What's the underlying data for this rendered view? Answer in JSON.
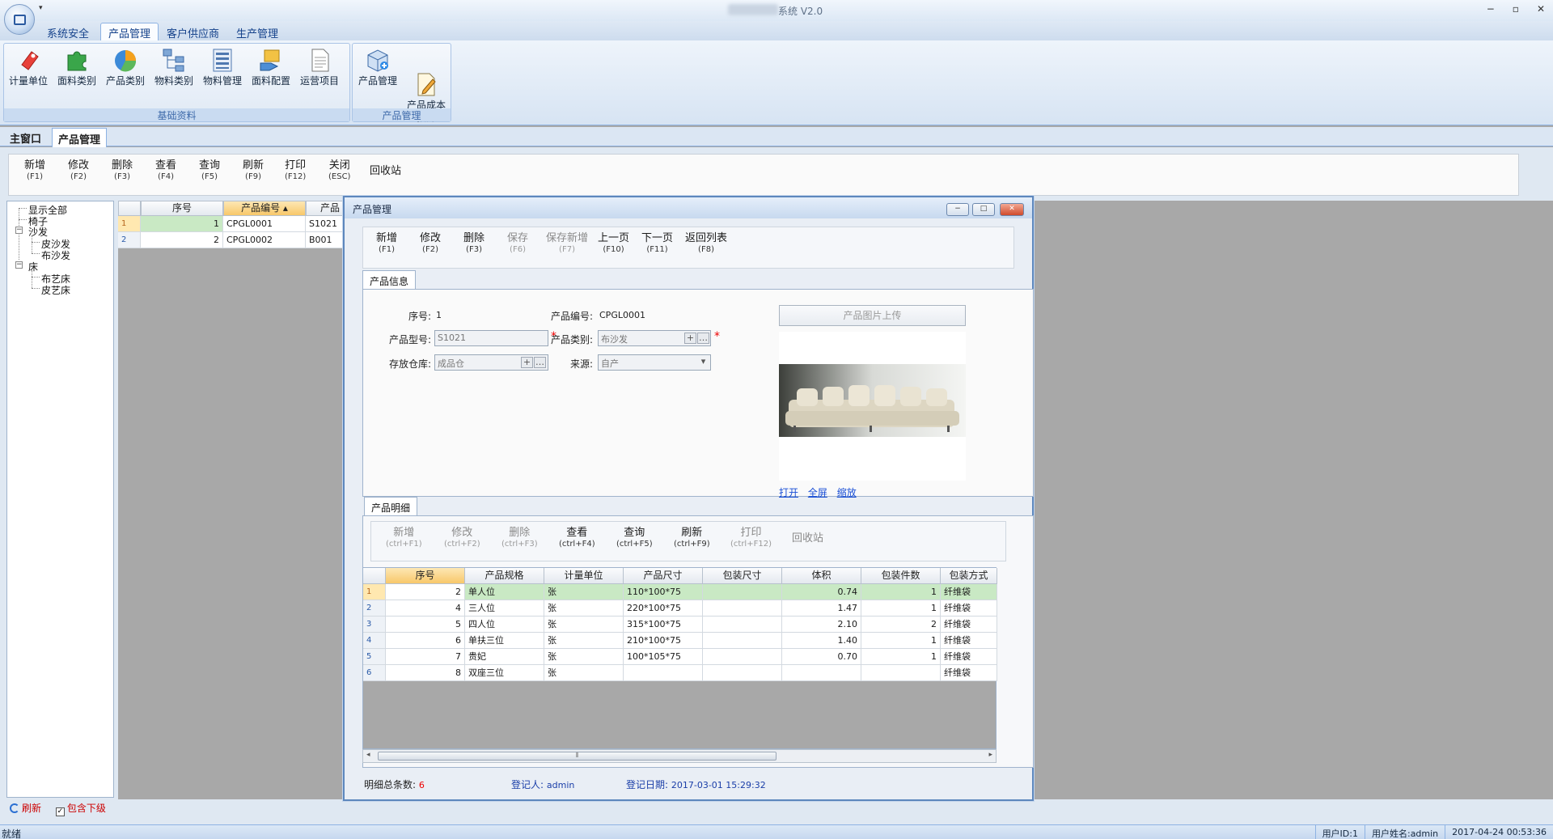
{
  "app": {
    "title": "系统 V2.0",
    "window_controls": [
      "−",
      "▫",
      "✕"
    ]
  },
  "ribbon": {
    "tabs": [
      "系统安全",
      "产品管理",
      "客户供应商",
      "生产管理"
    ],
    "active_tab": "产品管理",
    "groups": [
      {
        "label": "基础资料",
        "buttons": [
          {
            "label": "计量单位",
            "icon": "tag-icon"
          },
          {
            "label": "面料类别",
            "icon": "puzzle-icon"
          },
          {
            "label": "产品类别",
            "icon": "pie-icon"
          },
          {
            "label": "物料类别",
            "icon": "tree-icon"
          },
          {
            "label": "物料管理",
            "icon": "list-icon"
          },
          {
            "label": "面料配置",
            "icon": "hand-icon"
          },
          {
            "label": "运营项目",
            "icon": "document-icon"
          }
        ]
      },
      {
        "label": "产品管理",
        "buttons": [
          {
            "label": "产品管理",
            "icon": "box-icon"
          },
          {
            "label": "产品成本\n预算",
            "icon": "edit-icon"
          }
        ]
      }
    ]
  },
  "doc_tabs": [
    "主窗口",
    "产品管理"
  ],
  "main_toolbar": [
    {
      "label": "新增",
      "key": "(F1)"
    },
    {
      "label": "修改",
      "key": "(F2)"
    },
    {
      "label": "删除",
      "key": "(F3)"
    },
    {
      "label": "查看",
      "key": "(F4)"
    },
    {
      "label": "查询",
      "key": "(F5)"
    },
    {
      "label": "刷新",
      "key": "(F9)"
    },
    {
      "label": "打印",
      "key": "(F12)"
    },
    {
      "label": "关闭",
      "key": "(ESC)"
    },
    {
      "label": "回收站",
      "key": ""
    }
  ],
  "tree": {
    "show_all": "显示全部",
    "nodes": [
      "椅子",
      "沙发",
      "皮沙发",
      "布沙发",
      "床",
      "布艺床",
      "皮艺床"
    ],
    "footer_refresh": "刷新",
    "footer_include": "包含下级",
    "include_checked": "✓"
  },
  "main_grid": {
    "columns": [
      "序号",
      "产品编号",
      "产品"
    ],
    "rows": [
      {
        "n": "1",
        "seq": "1",
        "code": "CPGL0001",
        "model": "S1021"
      },
      {
        "n": "2",
        "seq": "2",
        "code": "CPGL0002",
        "model": "B001"
      }
    ]
  },
  "dialog": {
    "title": "产品管理",
    "buttons": [
      "−",
      "□",
      "✕"
    ],
    "toolbar": [
      {
        "label": "新增",
        "key": "(F1)",
        "enabled": true
      },
      {
        "label": "修改",
        "key": "(F2)",
        "enabled": true
      },
      {
        "label": "删除",
        "key": "(F3)",
        "enabled": true
      },
      {
        "label": "保存",
        "key": "(F6)",
        "enabled": false
      },
      {
        "label": "保存新增",
        "key": "(F7)",
        "enabled": false
      },
      {
        "label": "上一页",
        "key": "(F10)",
        "enabled": true
      },
      {
        "label": "下一页",
        "key": "(F11)",
        "enabled": true
      },
      {
        "label": "返回列表",
        "key": "(F8)",
        "enabled": true
      }
    ],
    "info_tab": "产品信息",
    "fields": {
      "seq_label": "序号:",
      "seq_value": "1",
      "code_label": "产品编号:",
      "code_value": "CPGL0001",
      "model_label": "产品型号:",
      "model_value": "S1021",
      "category_label": "产品类别:",
      "category_value": "布沙发",
      "warehouse_label": "存放仓库:",
      "warehouse_value": "成品仓",
      "source_label": "来源:",
      "source_value": "自产",
      "required_mark": "*"
    },
    "image": {
      "upload_label": "产品图片上传",
      "links": [
        "打开",
        "全屏",
        "缩放"
      ]
    },
    "detail_tab": "产品明细",
    "detail_toolbar": [
      {
        "label": "新增",
        "key": "(ctrl+F1)",
        "enabled": false
      },
      {
        "label": "修改",
        "key": "(ctrl+F2)",
        "enabled": false
      },
      {
        "label": "删除",
        "key": "(ctrl+F3)",
        "enabled": false
      },
      {
        "label": "查看",
        "key": "(ctrl+F4)",
        "enabled": true
      },
      {
        "label": "查询",
        "key": "(ctrl+F5)",
        "enabled": true
      },
      {
        "label": "刷新",
        "key": "(ctrl+F9)",
        "enabled": true
      },
      {
        "label": "打印",
        "key": "(ctrl+F12)",
        "enabled": false
      },
      {
        "label": "回收站",
        "key": "",
        "enabled": false
      }
    ],
    "detail_grid": {
      "columns": [
        "序号",
        "产品规格",
        "计量单位",
        "产品尺寸",
        "包装尺寸",
        "体积",
        "包装件数",
        "包装方式"
      ],
      "rows": [
        {
          "n": "1",
          "seq": "2",
          "spec": "单人位",
          "unit": "张",
          "size": "110*100*75",
          "pack": "",
          "vol": "0.74",
          "qty": "1",
          "method": "纤维袋"
        },
        {
          "n": "2",
          "seq": "4",
          "spec": "三人位",
          "unit": "张",
          "size": "220*100*75",
          "pack": "",
          "vol": "1.47",
          "qty": "1",
          "method": "纤维袋"
        },
        {
          "n": "3",
          "seq": "5",
          "spec": "四人位",
          "unit": "张",
          "size": "315*100*75",
          "pack": "",
          "vol": "2.10",
          "qty": "2",
          "method": "纤维袋"
        },
        {
          "n": "4",
          "seq": "6",
          "spec": "单扶三位",
          "unit": "张",
          "size": "210*100*75",
          "pack": "",
          "vol": "1.40",
          "qty": "1",
          "method": "纤维袋"
        },
        {
          "n": "5",
          "seq": "7",
          "spec": "贵妃",
          "unit": "张",
          "size": "100*105*75",
          "pack": "",
          "vol": "0.70",
          "qty": "1",
          "method": "纤维袋"
        },
        {
          "n": "6",
          "seq": "8",
          "spec": "双座三位",
          "unit": "张",
          "size": "",
          "pack": "",
          "vol": "",
          "qty": "",
          "method": "纤维袋"
        }
      ]
    },
    "scroll_grip": "⦀",
    "footer": {
      "total_label": "明细总条数:",
      "total_value": "6",
      "registrar_label": "登记人:",
      "registrar_value": "admin",
      "date_label": "登记日期:",
      "date_value": "2017-03-01 15:29:32"
    }
  },
  "status": {
    "left": "就绪",
    "user_id": "用户ID:1",
    "user_name": "用户姓名:admin",
    "datetime": "2017-04-24 00:53:36"
  },
  "colors": {
    "accent": "#8db2e3",
    "selected_row": "#c9e9c4",
    "sort_header": "#f8c86a",
    "required": "#e00000",
    "link": "#1a4fd6"
  }
}
